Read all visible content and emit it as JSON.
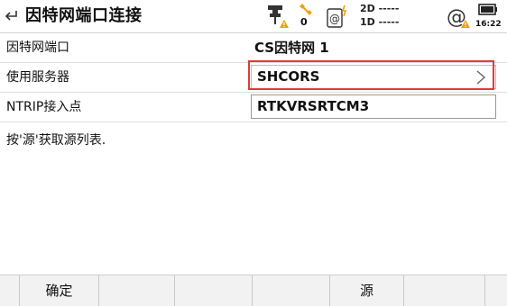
{
  "header": {
    "title": "因特网端口连接",
    "satellites": "0",
    "precision_2d": "2D -----",
    "precision_1d": "1D -----",
    "time": "16:22"
  },
  "form": {
    "rows": [
      {
        "label": "因特网端口",
        "value": "CS因特网 1"
      },
      {
        "label": "使用服务器",
        "value": "SHCORS"
      },
      {
        "label": "NTRIP接入点",
        "value": "RTKVRSRTCM3"
      }
    ],
    "hint": "按'源'获取源列表."
  },
  "softkeys": {
    "confirm": "确定",
    "source": "源"
  },
  "colors": {
    "highlight": "#e03a3a",
    "warning": "#f0a000"
  }
}
